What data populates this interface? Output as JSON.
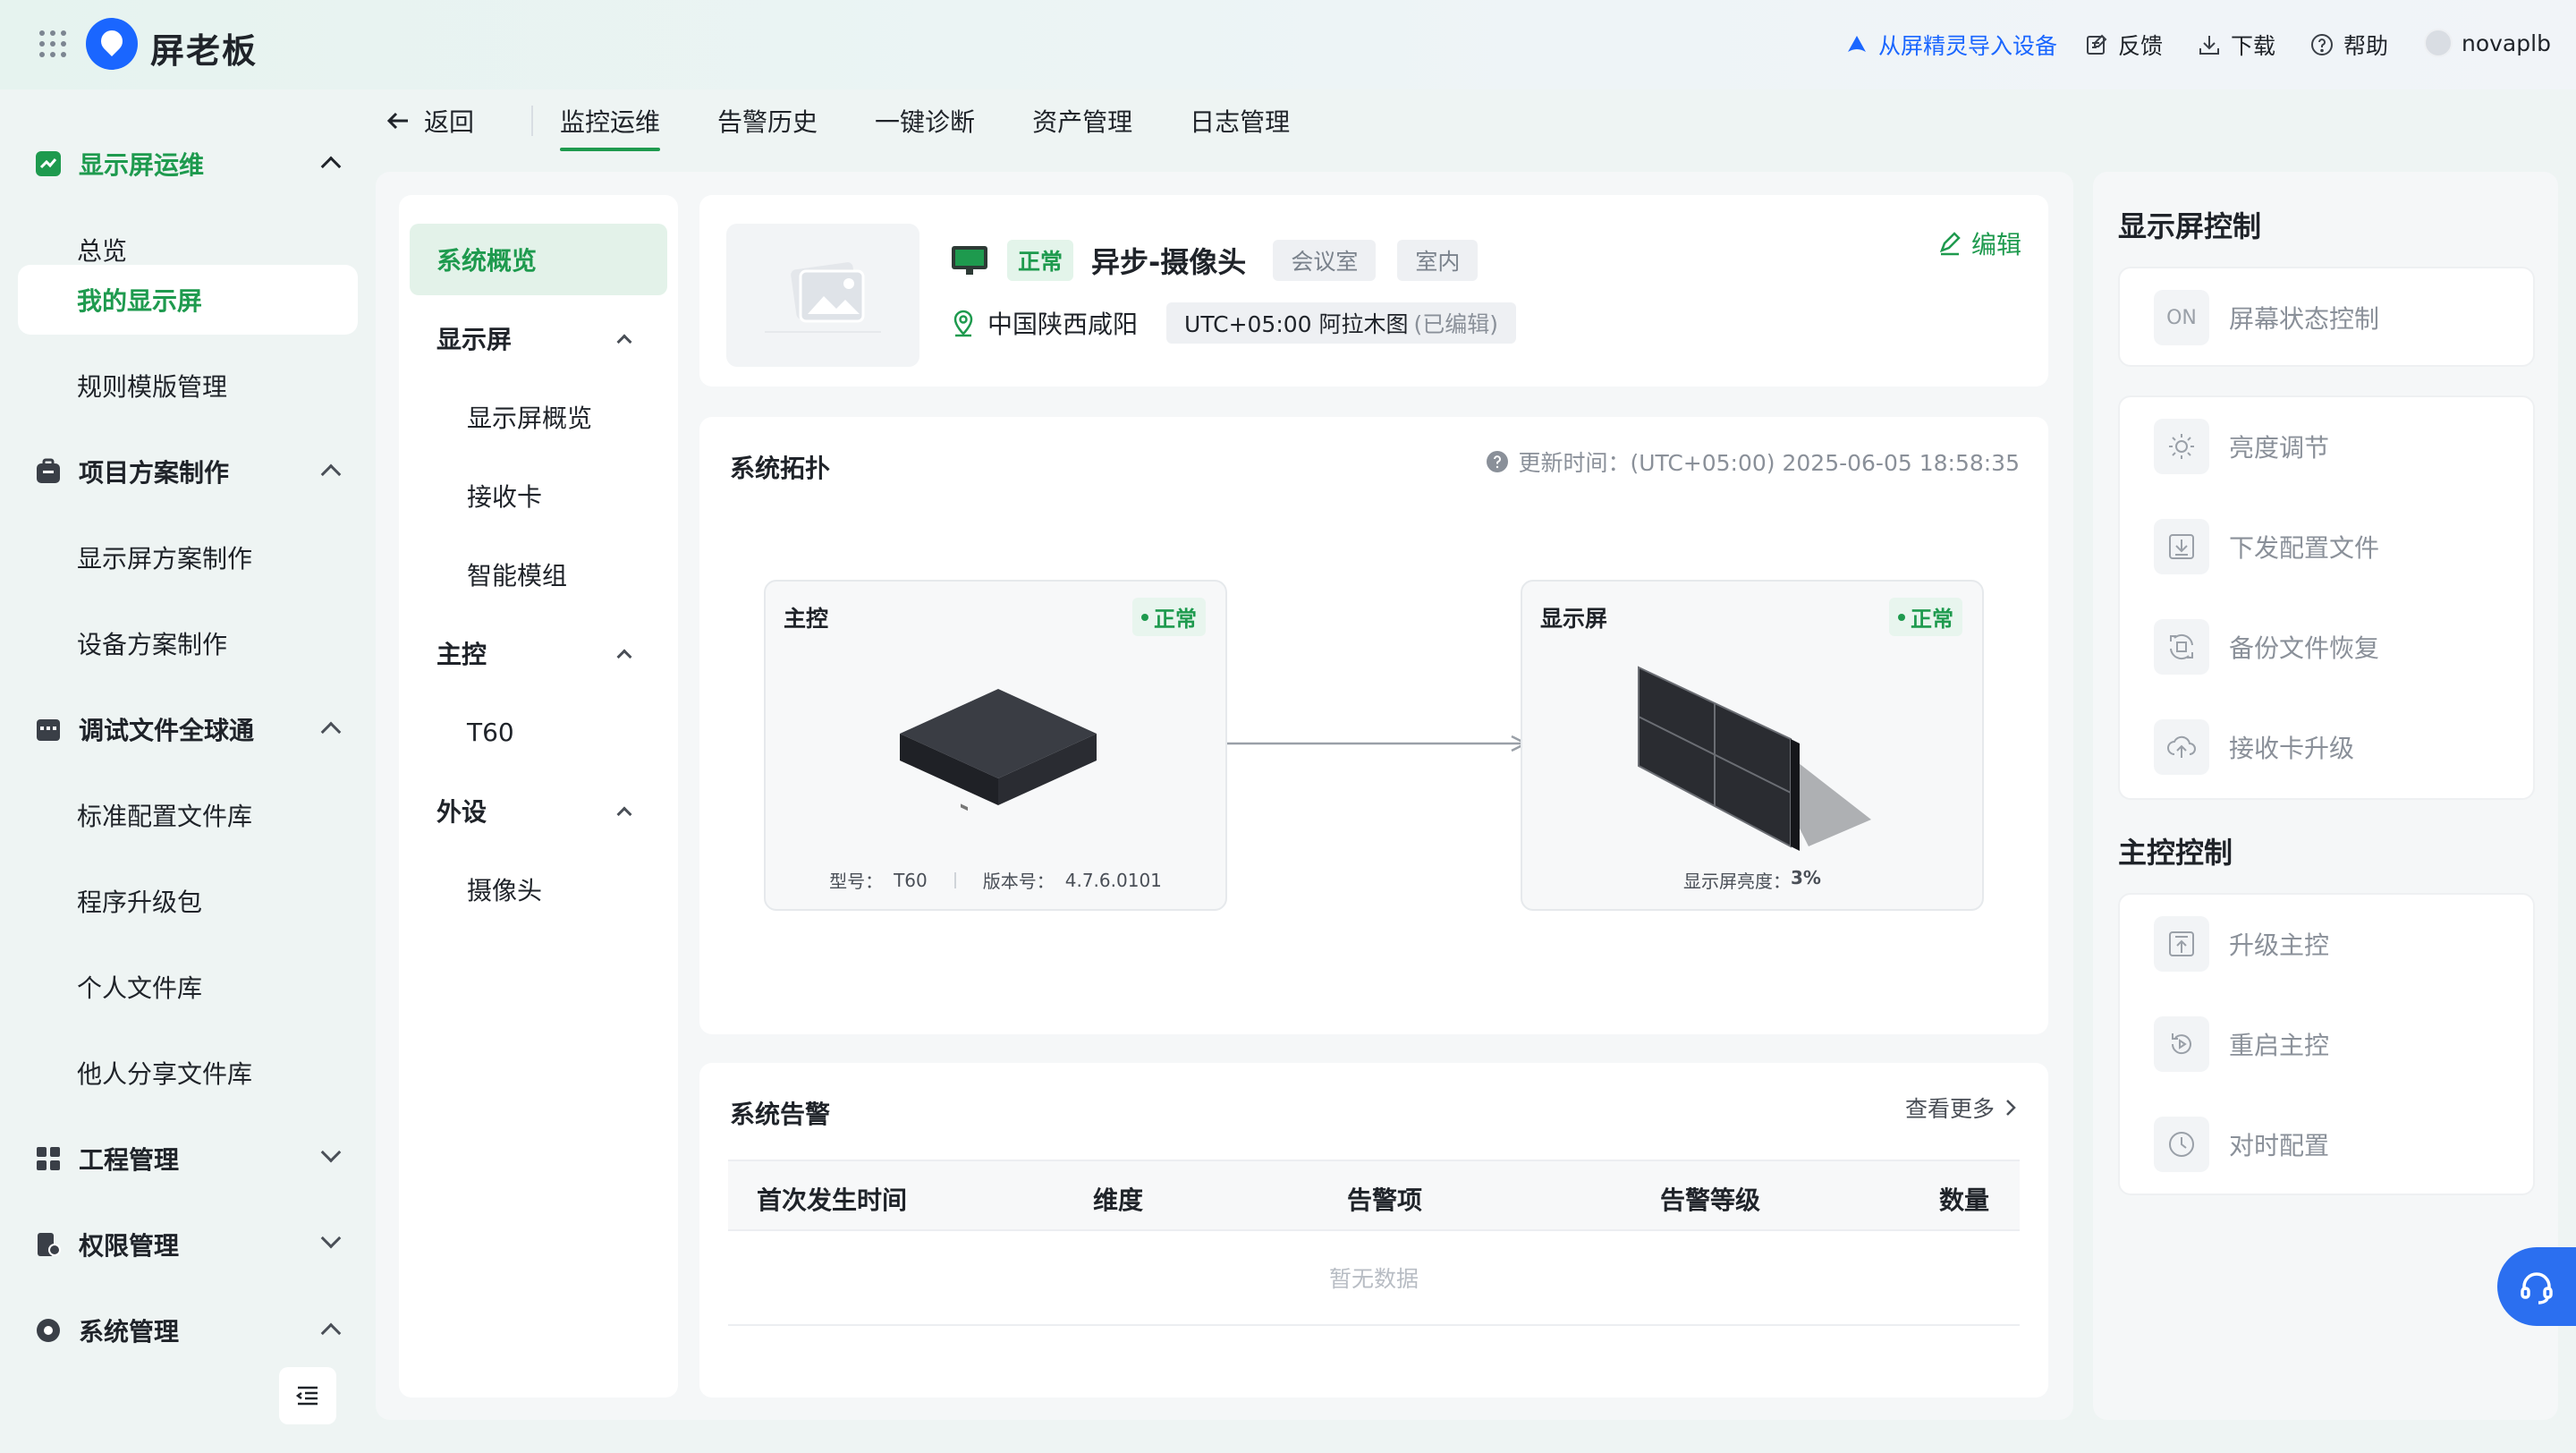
{
  "brand": {
    "name": "屏老板"
  },
  "header": {
    "import_label": "从屏精灵导入设备",
    "feedback_label": "反馈",
    "download_label": "下载",
    "help_label": "帮助",
    "user_name": "novaplb"
  },
  "sidebar": {
    "groups": [
      {
        "label": "显示屏运维",
        "items": [
          "总览",
          "我的显示屏",
          "规则模版管理"
        ]
      },
      {
        "label": "项目方案制作",
        "items": [
          "显示屏方案制作",
          "设备方案制作"
        ]
      },
      {
        "label": "调试文件全球通",
        "items": [
          "标准配置文件库",
          "程序升级包",
          "个人文件库",
          "他人分享文件库"
        ]
      },
      {
        "label": "工程管理",
        "items": []
      },
      {
        "label": "权限管理",
        "items": []
      },
      {
        "label": "系统管理",
        "items": []
      }
    ]
  },
  "tabs": {
    "back_label": "返回",
    "items": [
      "监控运维",
      "告警历史",
      "一键诊断",
      "资产管理",
      "日志管理"
    ]
  },
  "subnav": {
    "overview": "系统概览",
    "groups": [
      {
        "label": "显示屏",
        "items": [
          "显示屏概览",
          "接收卡",
          "智能模组"
        ]
      },
      {
        "label": "主控",
        "items": [
          "T60"
        ]
      },
      {
        "label": "外设",
        "items": [
          "摄像头"
        ]
      }
    ]
  },
  "device": {
    "status": "正常",
    "name": "异步-摄像头",
    "tags": [
      "会议室",
      "室内"
    ],
    "location": "中国陕西咸阳",
    "timezone": "UTC+05:00 阿拉木图",
    "timezone_note": "(已编辑)",
    "edit_label": "编辑"
  },
  "topology": {
    "title": "系统拓扑",
    "update_time": "更新时间：(UTC+05:00) 2025-06-05 18:58:35",
    "controller": {
      "title": "主控",
      "status": "正常",
      "model_label": "型号：",
      "model": "T60",
      "version_label": "版本号：",
      "version": "4.7.6.0101"
    },
    "screen": {
      "title": "显示屏",
      "status": "正常",
      "brightness_label": "显示屏亮度：",
      "brightness": "3%"
    }
  },
  "alarms": {
    "title": "系统告警",
    "more_label": "查看更多",
    "columns": [
      "首次发生时间",
      "维度",
      "告警项",
      "告警等级",
      "数量"
    ],
    "empty_text": "暂无数据"
  },
  "right_panel": {
    "screen_control_title": "显示屏控制",
    "screen_state_label": "屏幕状态控制",
    "on_badge": "ON",
    "screen_items": [
      "亮度调节",
      "下发配置文件",
      "备份文件恢复",
      "接收卡升级"
    ],
    "controller_title": "主控控制",
    "controller_items": [
      "升级主控",
      "重启主控",
      "对时配置"
    ]
  },
  "colors": {
    "accent_green": "#1e9a4e",
    "brand_blue": "#1a66ff"
  }
}
